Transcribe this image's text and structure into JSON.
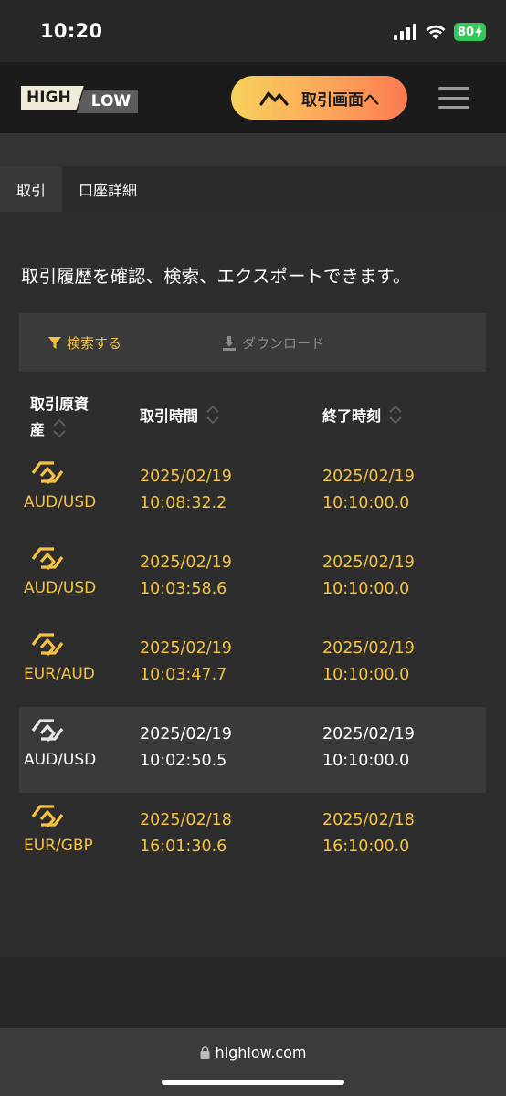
{
  "status": {
    "time": "10:20",
    "battery": "80"
  },
  "header": {
    "logo_high": "HIGH",
    "logo_low": "LOW",
    "trade_button": "取引画面へ"
  },
  "tabs": [
    {
      "label": "取引"
    },
    {
      "label": "口座詳細"
    }
  ],
  "description": "取引履歴を確認、検索、エクスポートできます。",
  "toolbar": {
    "search": "検索する",
    "download": "ダウンロード"
  },
  "table": {
    "headers": {
      "asset_line1": "取引原資",
      "asset_line2": "産",
      "trade_time": "取引時間",
      "end_time": "終了時刻"
    },
    "rows": [
      {
        "asset": "AUD/USD",
        "trade_date": "2025/02/19",
        "trade_time": "10:08:32.2",
        "end_date": "2025/02/19",
        "end_time": "10:10:00.0",
        "color": "#f5c242"
      },
      {
        "asset": "AUD/USD",
        "trade_date": "2025/02/19",
        "trade_time": "10:03:58.6",
        "end_date": "2025/02/19",
        "end_time": "10:10:00.0",
        "color": "#f5c242"
      },
      {
        "asset": "EUR/AUD",
        "trade_date": "2025/02/19",
        "trade_time": "10:03:47.7",
        "end_date": "2025/02/19",
        "end_time": "10:10:00.0",
        "color": "#f5c242"
      },
      {
        "asset": "AUD/USD",
        "trade_date": "2025/02/19",
        "trade_time": "10:02:50.5",
        "end_date": "2025/02/19",
        "end_time": "10:10:00.0",
        "color": "#ffffff"
      },
      {
        "asset": "EUR/GBP",
        "trade_date": "2025/02/18",
        "trade_time": "16:01:30.6",
        "end_date": "2025/02/18",
        "end_time": "16:10:00.0",
        "color": "#f5c242"
      }
    ]
  },
  "browser": {
    "url": "highlow.com"
  },
  "colors": {
    "accent_gold": "#f5c242",
    "background": "#2d2d2d"
  }
}
